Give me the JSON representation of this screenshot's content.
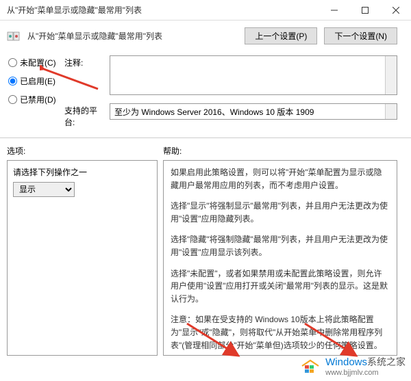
{
  "window": {
    "title": "从\"开始\"菜单显示或隐藏\"最常用\"列表"
  },
  "header": {
    "title": "从\"开始\"菜单显示或隐藏\"最常用\"列表",
    "prev_btn": "上一个设置(P)",
    "next_btn": "下一个设置(N)"
  },
  "radios": {
    "not_configured": "未配置(C)",
    "enabled": "已启用(E)",
    "disabled": "已禁用(D)",
    "selected": "enabled"
  },
  "config": {
    "comment_label": "注释:",
    "platform_label": "支持的平台:",
    "platform_value": "至少为 Windows Server 2016、Windows 10 版本 1909"
  },
  "labels": {
    "options": "选项:",
    "help": "帮助:"
  },
  "options": {
    "select_prompt": "请选择下列操作之一",
    "select_value": "显示"
  },
  "help": {
    "p1": "如果启用此策略设置，则可以将\"开始\"菜单配置为显示或隐藏用户最常用应用的列表，而不考虑用户设置。",
    "p2": "选择\"显示\"将强制显示\"最常用\"列表，并且用户无法更改为使用\"设置\"应用隐藏列表。",
    "p3": "选择\"隐藏\"将强制隐藏\"最常用\"列表，并且用户无法更改为使用\"设置\"应用显示该列表。",
    "p4": "选择\"未配置\"，或者如果禁用或未配置此策略设置，则允许用户使用\"设置\"应用打开或关闭\"最常用\"列表的显示。这是默认行为。",
    "p5": "注意：如果在受支持的 Windows 10版本上将此策略配置为\"显示\"或\"隐藏\"，则将取代\"从开始菜单中删除常用程序列表\"(管理相同部分\"开始\"菜单但)选项较少的任何策略设置。"
  },
  "watermark": {
    "main": "Windows",
    "cn": "系统之家",
    "url": "www.bjjmlv.com"
  }
}
